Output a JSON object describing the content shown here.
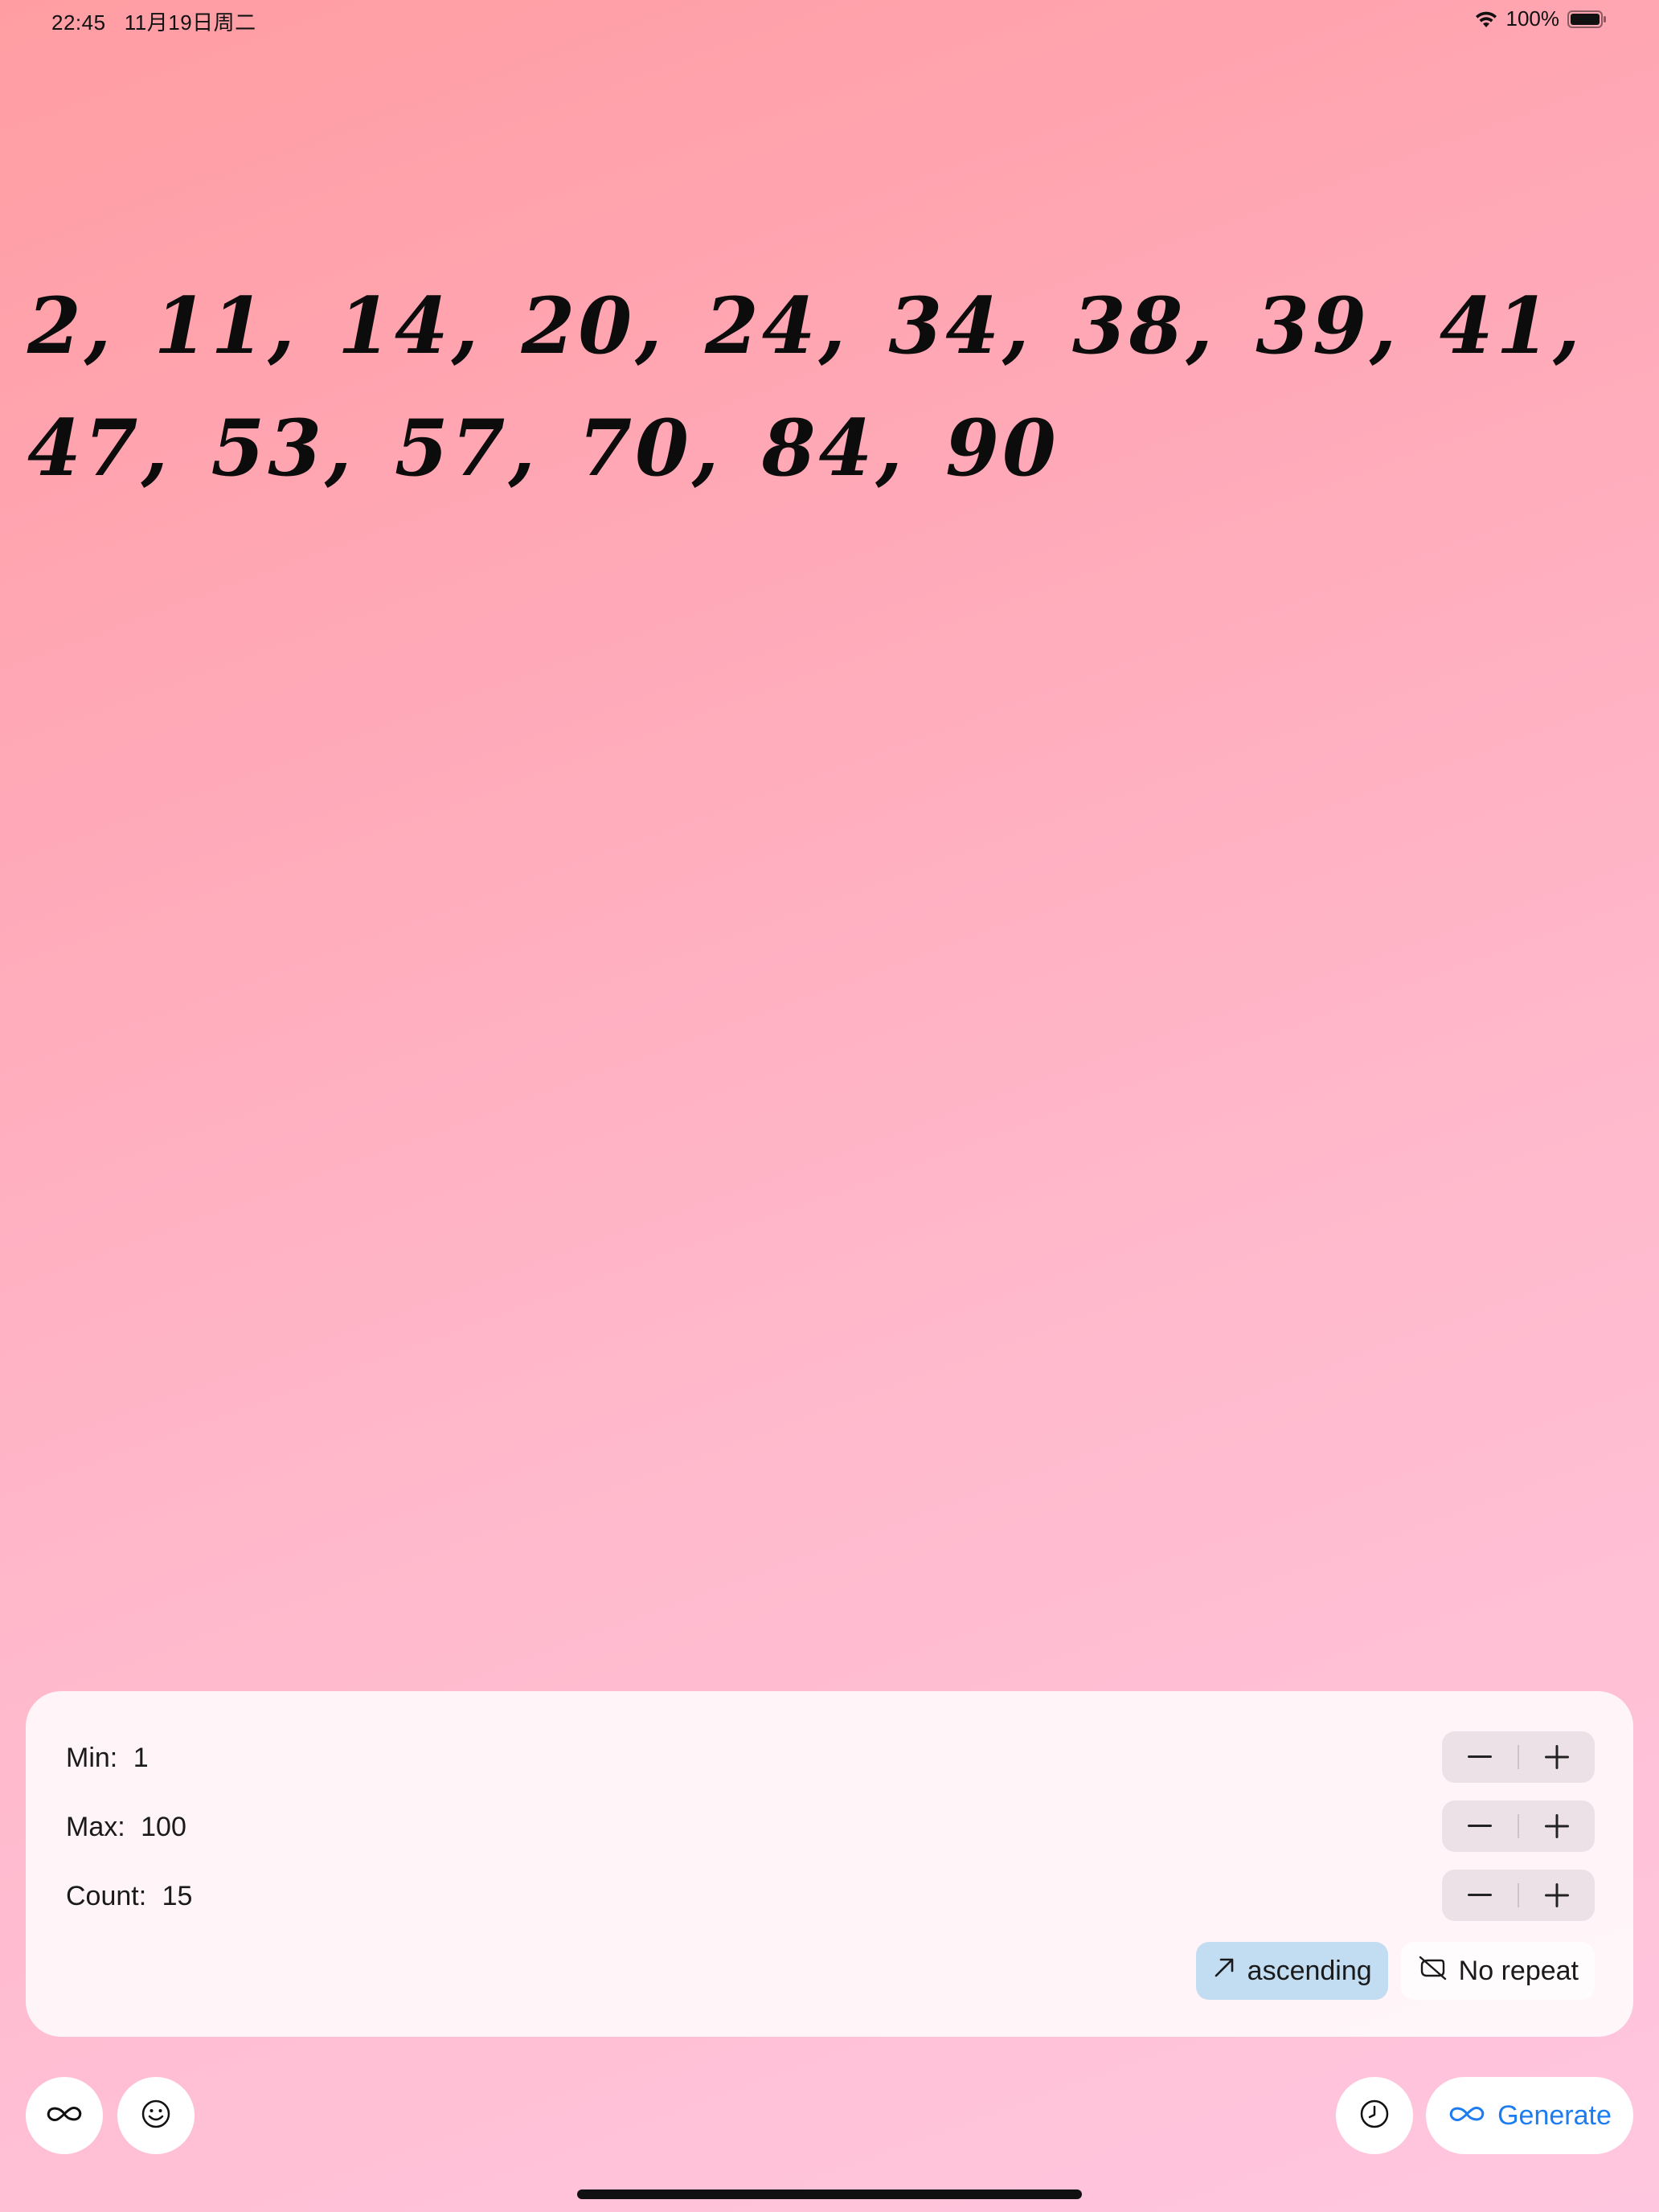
{
  "status_bar": {
    "time": "22:45",
    "date": "11月19日周二",
    "battery_percent": "100%",
    "battery_level": 1.0
  },
  "result": {
    "numbers": "2, 11, 14, 20, 24, 34, 38, 39, 41, 47, 53, 57, 70, 84, 90"
  },
  "settings": {
    "min": {
      "label": "Min:",
      "value": "1"
    },
    "max": {
      "label": "Max:",
      "value": "100"
    },
    "count": {
      "label": "Count:",
      "value": "15"
    },
    "sort_label": "ascending",
    "repeat_label": "No repeat"
  },
  "toolbar": {
    "generate_label": "Generate"
  },
  "icons": {
    "infinity": "infinity-icon",
    "smiley": "smiley-icon",
    "history": "clock-icon",
    "sort": "arrow-up-right-icon",
    "repeat": "no-repeat-icon"
  },
  "colors": {
    "accent": "#1c7cf0",
    "active_pill": "#c2dcf2"
  }
}
